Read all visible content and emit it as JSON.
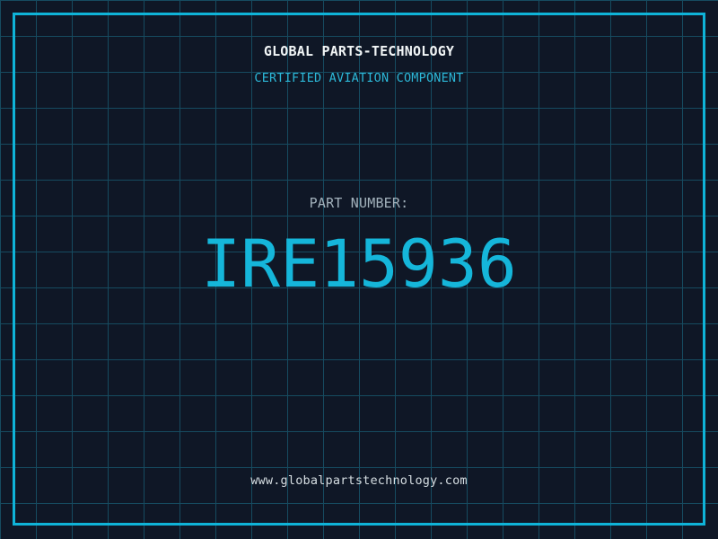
{
  "label": {
    "brand": "GLOBAL PARTS-TECHNOLOGY",
    "subtitle": "CERTIFIED AVIATION COMPONENT",
    "part_label": "PART NUMBER:",
    "part_number": "IRE15936",
    "website": "www.globalpartstechnology.com"
  },
  "colors": {
    "background": "#0f1726",
    "grid_line": "#164b60",
    "frame": "#0fb3d8",
    "accent_cyan": "#15b6da",
    "subtitle_cyan": "#2cb8d8",
    "brand_text": "#f2f6f7",
    "muted_text": "#a3b2bc",
    "website_text": "#d6dee2"
  }
}
